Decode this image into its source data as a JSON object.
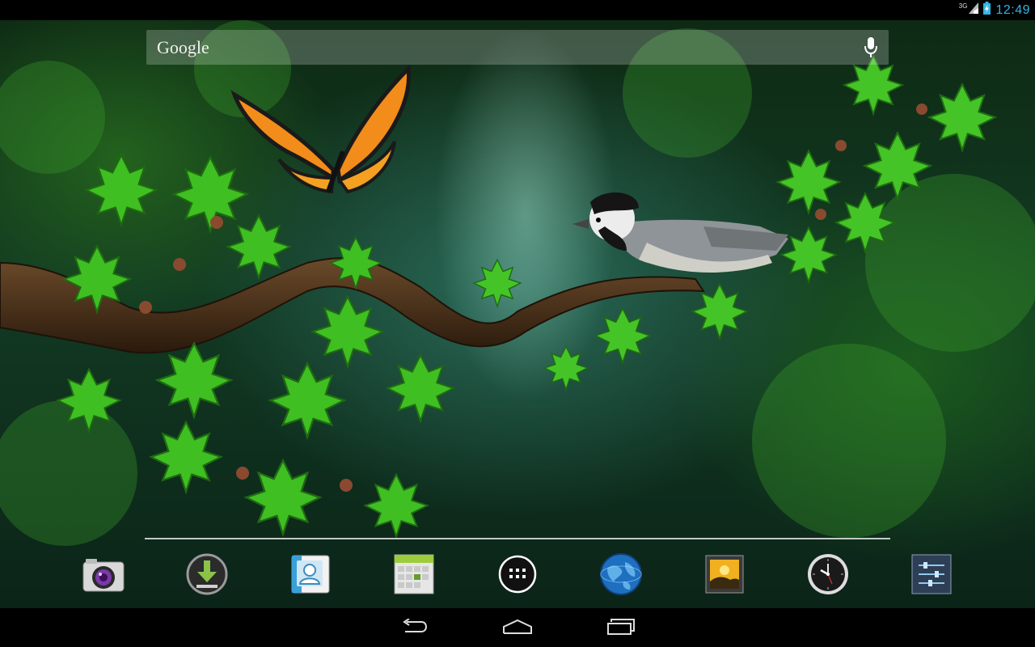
{
  "status_bar": {
    "network_type": "3G",
    "time": "12:49",
    "icons": [
      "signal-icon",
      "battery-charging-icon"
    ],
    "clock_color": "#33b5e5"
  },
  "search": {
    "logo_text": "Google",
    "voice_icon": "mic-icon"
  },
  "dock": {
    "items": [
      {
        "icon": "camera-icon"
      },
      {
        "icon": "download-icon"
      },
      {
        "icon": "contacts-icon"
      },
      {
        "icon": "calendar-icon"
      },
      {
        "icon": "all-apps-icon"
      },
      {
        "icon": "browser-globe-icon"
      },
      {
        "icon": "gallery-icon"
      },
      {
        "icon": "clock-icon"
      },
      {
        "icon": "settings-icon"
      }
    ]
  },
  "nav_bar": {
    "buttons": [
      {
        "icon": "back-icon"
      },
      {
        "icon": "home-icon"
      },
      {
        "icon": "recent-apps-icon"
      }
    ]
  },
  "wallpaper": {
    "icon": "live-wallpaper-forest-bird-butterfly"
  }
}
